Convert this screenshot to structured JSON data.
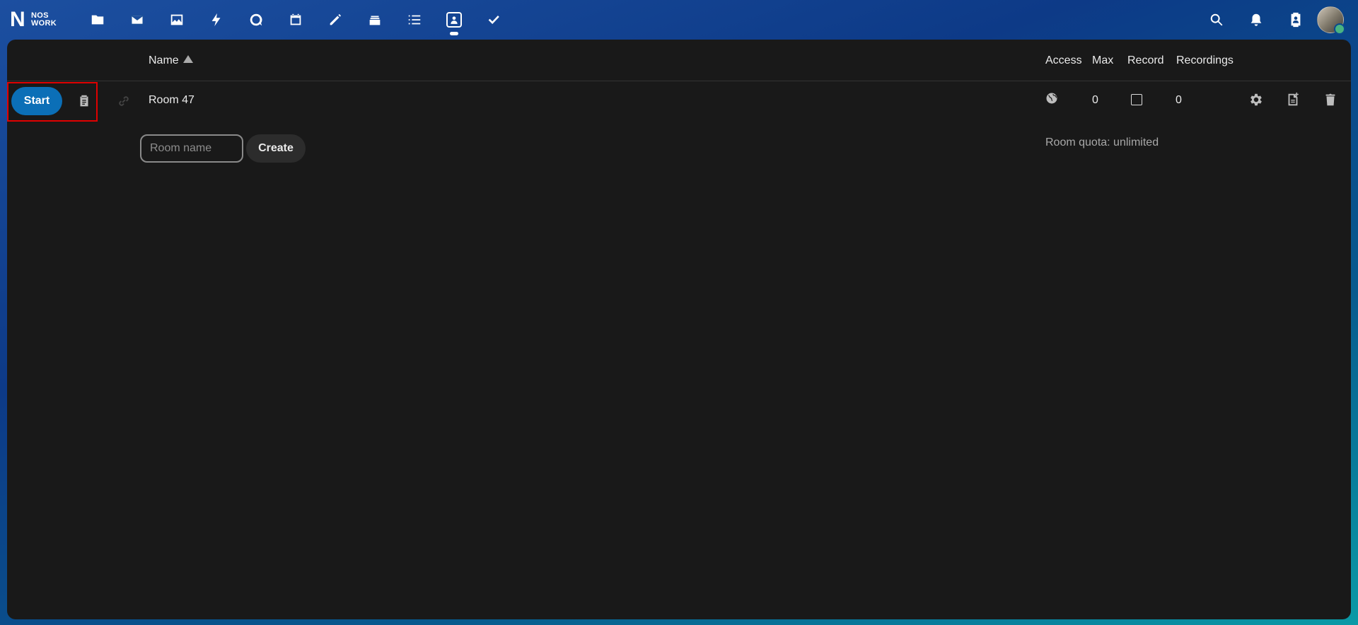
{
  "logo": {
    "letter": "N",
    "line1": "NOS",
    "line2": "WORK"
  },
  "nav": {
    "apps": [
      {
        "name": "files-icon"
      },
      {
        "name": "mail-icon"
      },
      {
        "name": "photos-icon"
      },
      {
        "name": "activity-icon"
      },
      {
        "name": "talk-icon"
      },
      {
        "name": "calendar-icon"
      },
      {
        "name": "notes-icon"
      },
      {
        "name": "deck-icon"
      },
      {
        "name": "tasks-icon"
      },
      {
        "name": "bbb-icon",
        "active": true
      },
      {
        "name": "checkmark-icon"
      }
    ],
    "right": [
      "search-icon",
      "notifications-icon",
      "contacts-icon"
    ],
    "avatar_status_color": "#49b382"
  },
  "table": {
    "headers": {
      "name": "Name",
      "access": "Access",
      "max": "Max",
      "record": "Record",
      "recordings": "Recordings"
    },
    "sort": "ascending",
    "rows": [
      {
        "start_label": "Start",
        "room_name": "Room 47",
        "access_icon": "globe-icon",
        "max": "0",
        "record": false,
        "recordings": "0"
      }
    ]
  },
  "create": {
    "placeholder": "Room name",
    "button_label": "Create",
    "quota_text": "Room quota: unlimited"
  },
  "colors": {
    "accent": "#0b6fb7",
    "highlight_border": "#e00000",
    "panel_bg": "#191919"
  }
}
